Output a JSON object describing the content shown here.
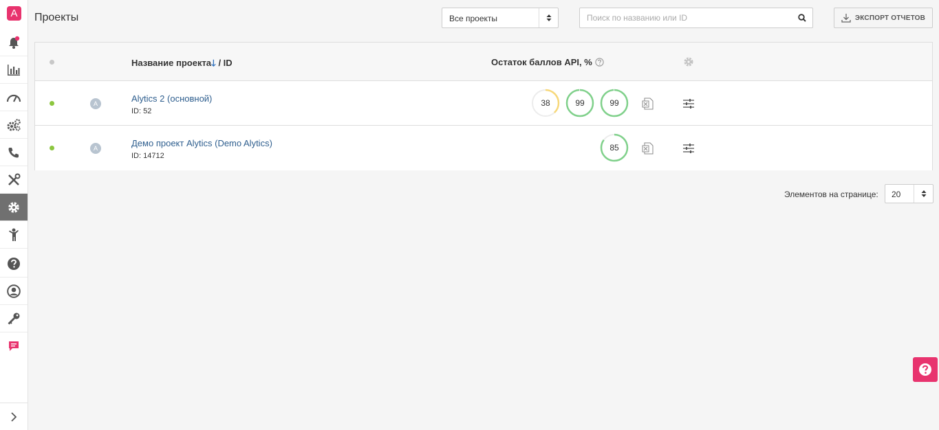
{
  "sidebar": {
    "logo_letter": "A",
    "items": [
      {
        "name": "notifications",
        "icon": "bell-icon"
      },
      {
        "name": "reports",
        "icon": "bar-chart-icon"
      },
      {
        "name": "dashboard",
        "icon": "speedometer-icon"
      },
      {
        "name": "automation",
        "icon": "gears-icon"
      },
      {
        "name": "calls",
        "icon": "phone-icon"
      },
      {
        "name": "tools",
        "icon": "tools-icon"
      },
      {
        "name": "settings",
        "icon": "gear-icon",
        "active": true
      },
      {
        "name": "users",
        "icon": "person-icon"
      },
      {
        "name": "help",
        "icon": "question-icon"
      },
      {
        "name": "account",
        "icon": "user-circle-icon"
      },
      {
        "name": "access",
        "icon": "key-icon"
      },
      {
        "name": "chat",
        "icon": "chat-icon"
      }
    ]
  },
  "header": {
    "title": "Проекты",
    "filter_value": "Все проекты",
    "search_placeholder": "Поиск по названию или ID",
    "export_label": "ЭКСПОРТ ОТЧЕТОВ"
  },
  "table": {
    "col_name": "Название проекта",
    "col_name_sort_arrow": "🡓",
    "col_id": "/ ID",
    "col_api": "Остаток баллов API, %",
    "rows": [
      {
        "name": "Alytics 2 (основной)",
        "id": "ID: 52",
        "status_color": "#8cc63f",
        "avatar": "A",
        "api": [
          38,
          99,
          99
        ]
      },
      {
        "name": "Демо проект Alytics (Demo Alytics)",
        "id": "ID: 14712",
        "status_color": "#8cc63f",
        "avatar": "A",
        "api": [
          85
        ]
      }
    ]
  },
  "pagination": {
    "label": "Элементов на странице:",
    "value": "20"
  },
  "colors": {
    "accent": "#e8336e",
    "gauge_green": "#7fd08a",
    "gauge_yellow": "#f7d87a",
    "link": "#2e5e8e"
  }
}
